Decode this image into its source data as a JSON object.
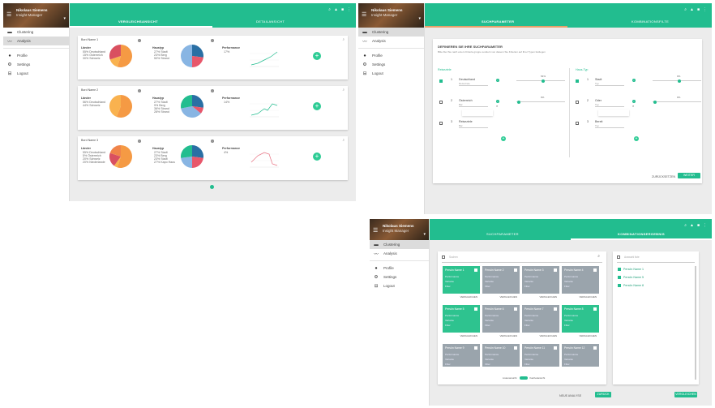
{
  "sidebar": {
    "user_name": "Nikolaus Siemens",
    "user_role": "Insight Manager",
    "items": [
      {
        "label": "Clustering",
        "icon": "cluster-icon"
      },
      {
        "label": "Analysis",
        "icon": "trend-icon"
      },
      {
        "label": "Profile",
        "icon": "person-icon"
      },
      {
        "label": "Settings",
        "icon": "gear-icon"
      },
      {
        "label": "Logout",
        "icon": "logout-icon"
      }
    ]
  },
  "panel1": {
    "tabs": [
      "VERGLEICHSANSICHT",
      "DETAILANSICHT"
    ],
    "cards": [
      {
        "title": "Bord Name 1",
        "col1_title": "Länder",
        "col1_items": [
          "55% Deutschland",
          "15% Österreich",
          "30% Schweiz"
        ],
        "col2_title": "Haustyp",
        "col2_items": [
          "27% Stadt",
          "23% Berg",
          "50% Strand"
        ],
        "col3_title": "Performance",
        "col3_value": "17%",
        "pie1": [
          55,
          15,
          30
        ],
        "pie2": [
          27,
          23,
          50
        ]
      },
      {
        "title": "Bord Name 2",
        "col1_title": "Länder",
        "col1_items": [
          "56% Deutschland",
          "44% Schweiz"
        ],
        "col2_title": "Haustyp",
        "col2_items": [
          "27% Stadt",
          "9% Berg",
          "36% Strand",
          "28% Strand"
        ],
        "col3_title": "Performance",
        "col3_value": "14%",
        "pie1": [
          56,
          44
        ],
        "pie2": [
          27,
          9,
          36,
          28
        ]
      },
      {
        "title": "Bord Name 3",
        "col1_title": "Länder",
        "col1_items": [
          "55% Deutschland",
          "5% Österreich",
          "20% Schweiz",
          "20% Niederlande"
        ],
        "col2_title": "Haustyp",
        "col2_items": [
          "27% Stadt",
          "23% Berg",
          "23% Stadt",
          "27% Kapo Haus"
        ],
        "col3_title": "Performance",
        "col3_value": "4%",
        "pie1": [
          55,
          5,
          20,
          20
        ],
        "pie2": [
          27,
          23,
          23,
          27
        ]
      }
    ]
  },
  "panel2": {
    "tabs": [
      "SUCHPARAMETER",
      "KOMBINATIONSFILTE"
    ],
    "heading": "DEFINIEREN SIE IHRE SUCHPARAMETER",
    "subheading": "Bitte fiter Sie nach einem Kriteria gruppe sondern von diesem Sie Kriterien auf Ihrer Typen festlegen",
    "left_title": "Reiseziele",
    "right_title": "Haus-Typ",
    "left_rows": [
      {
        "num": "1",
        "label": "Deutschland",
        "sub": "Reiseziele",
        "pct": "54%"
      },
      {
        "num": "2",
        "label": "Österreich",
        "sub": "Bar",
        "pct": "0%"
      },
      {
        "num": "3",
        "label": "Reiseziele",
        "sub": "Bar",
        "pct": ""
      }
    ],
    "right_rows": [
      {
        "num": "1",
        "label": "Stadt",
        "sub": "Typ",
        "pct": "0%"
      },
      {
        "num": "2",
        "label": "Oder",
        "sub": "Typ",
        "pct": "0%"
      },
      {
        "num": "3",
        "label": "Bereit",
        "sub": "Typ",
        "pct": ""
      }
    ],
    "buttons": {
      "reset": "ZURÜCKSETZEN",
      "next": "WEITER"
    }
  },
  "panel3": {
    "tabs": [
      "SUCHPARAMETER",
      "KOMBINATIONSERGEBNIS"
    ],
    "search_placeholder": "Suchen",
    "tiles": [
      {
        "name": "Persön Name 1",
        "on": true
      },
      {
        "name": "Persön Name 2",
        "on": false
      },
      {
        "name": "Persön Name 3",
        "on": false
      },
      {
        "name": "Persön Name 4",
        "on": false
      },
      {
        "name": "Persön Name 5",
        "on": true
      },
      {
        "name": "Persön Name 6",
        "on": false
      },
      {
        "name": "Persön Name 7",
        "on": false
      },
      {
        "name": "Persön Name 8",
        "on": true
      },
      {
        "name": "Persön Name 9",
        "on": false
      },
      {
        "name": "Persön Name 10",
        "on": false
      },
      {
        "name": "Persön Name 11",
        "on": false
      },
      {
        "name": "Persön Name 12",
        "on": false
      }
    ],
    "tile_rows": [
      "Performance",
      "Variante",
      "Filter"
    ],
    "tile_action": "VERGLEICHEN",
    "toggle_left": "Listenansicht",
    "toggle_right": "Kachelansicht",
    "right_list_header": "Auswahl liste",
    "right_list": [
      "Persön Name 1",
      "Persön Name 5",
      "Persön Name 8"
    ],
    "buttons": {
      "back": "ZURÜCK",
      "reset": "NEUE ANALYSE",
      "compare": "VERGLEICHEN"
    }
  }
}
